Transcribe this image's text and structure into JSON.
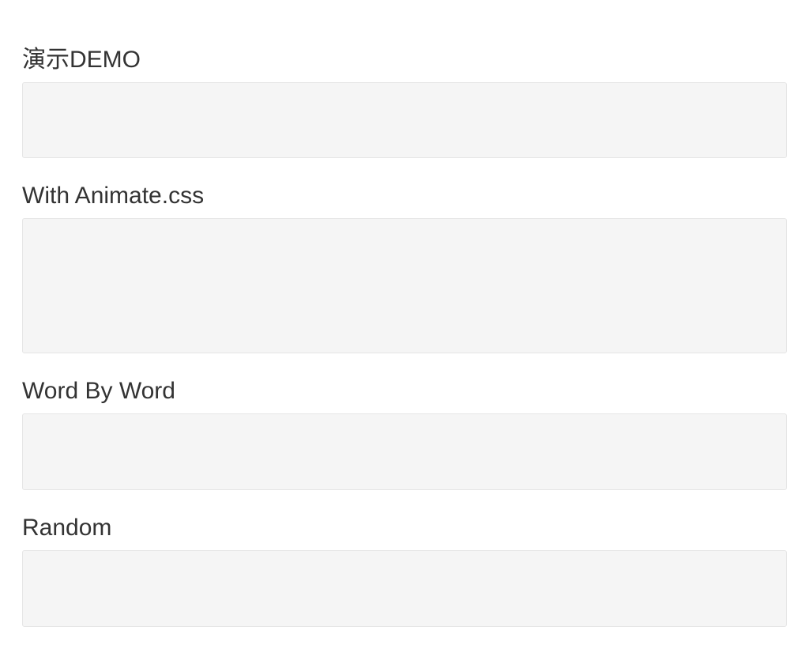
{
  "sections": [
    {
      "heading": "演示DEMO"
    },
    {
      "heading": "With Animate.css"
    },
    {
      "heading": "Word By Word"
    },
    {
      "heading": "Random"
    }
  ]
}
